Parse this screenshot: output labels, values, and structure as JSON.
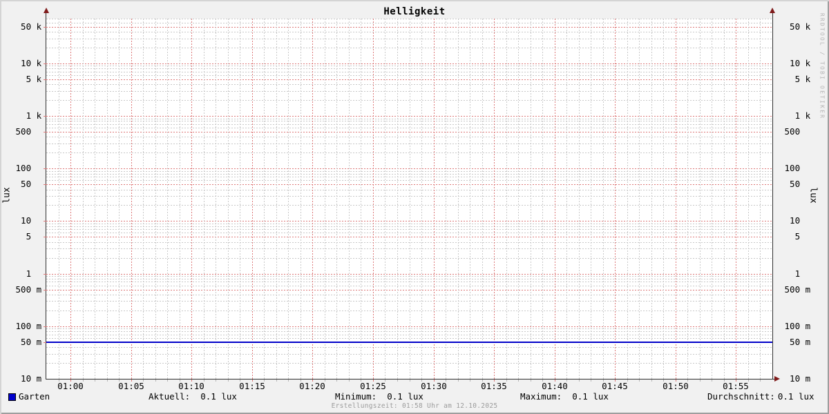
{
  "chart_data": {
    "type": "line",
    "title": "Helligkeit",
    "y_axis": {
      "label_left": "lux",
      "label_right": "lux",
      "scale": "log",
      "range": [
        0.01,
        71000
      ],
      "ticks": [
        {
          "value": 0.01,
          "label": "10 m"
        },
        {
          "value": 0.05,
          "label": "50 m"
        },
        {
          "value": 0.1,
          "label": "100 m"
        },
        {
          "value": 0.5,
          "label": "500 m"
        },
        {
          "value": 1,
          "label": "1"
        },
        {
          "value": 5,
          "label": "5"
        },
        {
          "value": 10,
          "label": "10"
        },
        {
          "value": 50,
          "label": "50"
        },
        {
          "value": 100,
          "label": "100"
        },
        {
          "value": 500,
          "label": "500"
        },
        {
          "value": 1000,
          "label": "1 k"
        },
        {
          "value": 5000,
          "label": "5 k"
        },
        {
          "value": 10000,
          "label": "10 k"
        },
        {
          "value": 50000,
          "label": "50 k"
        }
      ]
    },
    "x_axis": {
      "total_minutes": 60,
      "minor_step_minutes": 1,
      "major_step_minutes": 5,
      "ticks": [
        {
          "minute": 2,
          "label": "01:00"
        },
        {
          "minute": 7,
          "label": "01:05"
        },
        {
          "minute": 12,
          "label": "01:10"
        },
        {
          "minute": 17,
          "label": "01:15"
        },
        {
          "minute": 22,
          "label": "01:20"
        },
        {
          "minute": 27,
          "label": "01:25"
        },
        {
          "minute": 32,
          "label": "01:30"
        },
        {
          "minute": 37,
          "label": "01:35"
        },
        {
          "minute": 42,
          "label": "01:40"
        },
        {
          "minute": 47,
          "label": "01:45"
        },
        {
          "minute": 52,
          "label": "01:50"
        },
        {
          "minute": 57,
          "label": "01:55"
        }
      ]
    },
    "series": [
      {
        "name": "Garten",
        "type": "hline",
        "value": 0.05,
        "color": "#0000c8",
        "swatch_color": "#0000cc"
      }
    ],
    "stats": [
      {
        "label": "Aktuell:",
        "value": "0.1 lux"
      },
      {
        "label": "Minimum:",
        "value": "0.1 lux"
      },
      {
        "label": "Maximum:",
        "value": "0.1 lux"
      },
      {
        "label": "Durchschnitt:",
        "value": "0.1 lux"
      }
    ],
    "footer": "Erstellungszeit: 01:58 Uhr am 12.10.2025",
    "watermark": "RRDTOOL / TOBI OETIKER",
    "colors": {
      "background": "#f1f1f1",
      "canvas": "#ffffff",
      "grid_major": "#dd7777",
      "grid_minor": "#c8c8c8",
      "axis": "#2e2e2e",
      "arrow": "#7f1a1a",
      "line": "#0000c8",
      "text": "#000000",
      "footer_text": "#9b9b9b",
      "watermark_text": "#b5b5b5",
      "shade_top_left": "#d4d4d4",
      "shade_bottom_right": "#9e9e9e"
    }
  }
}
